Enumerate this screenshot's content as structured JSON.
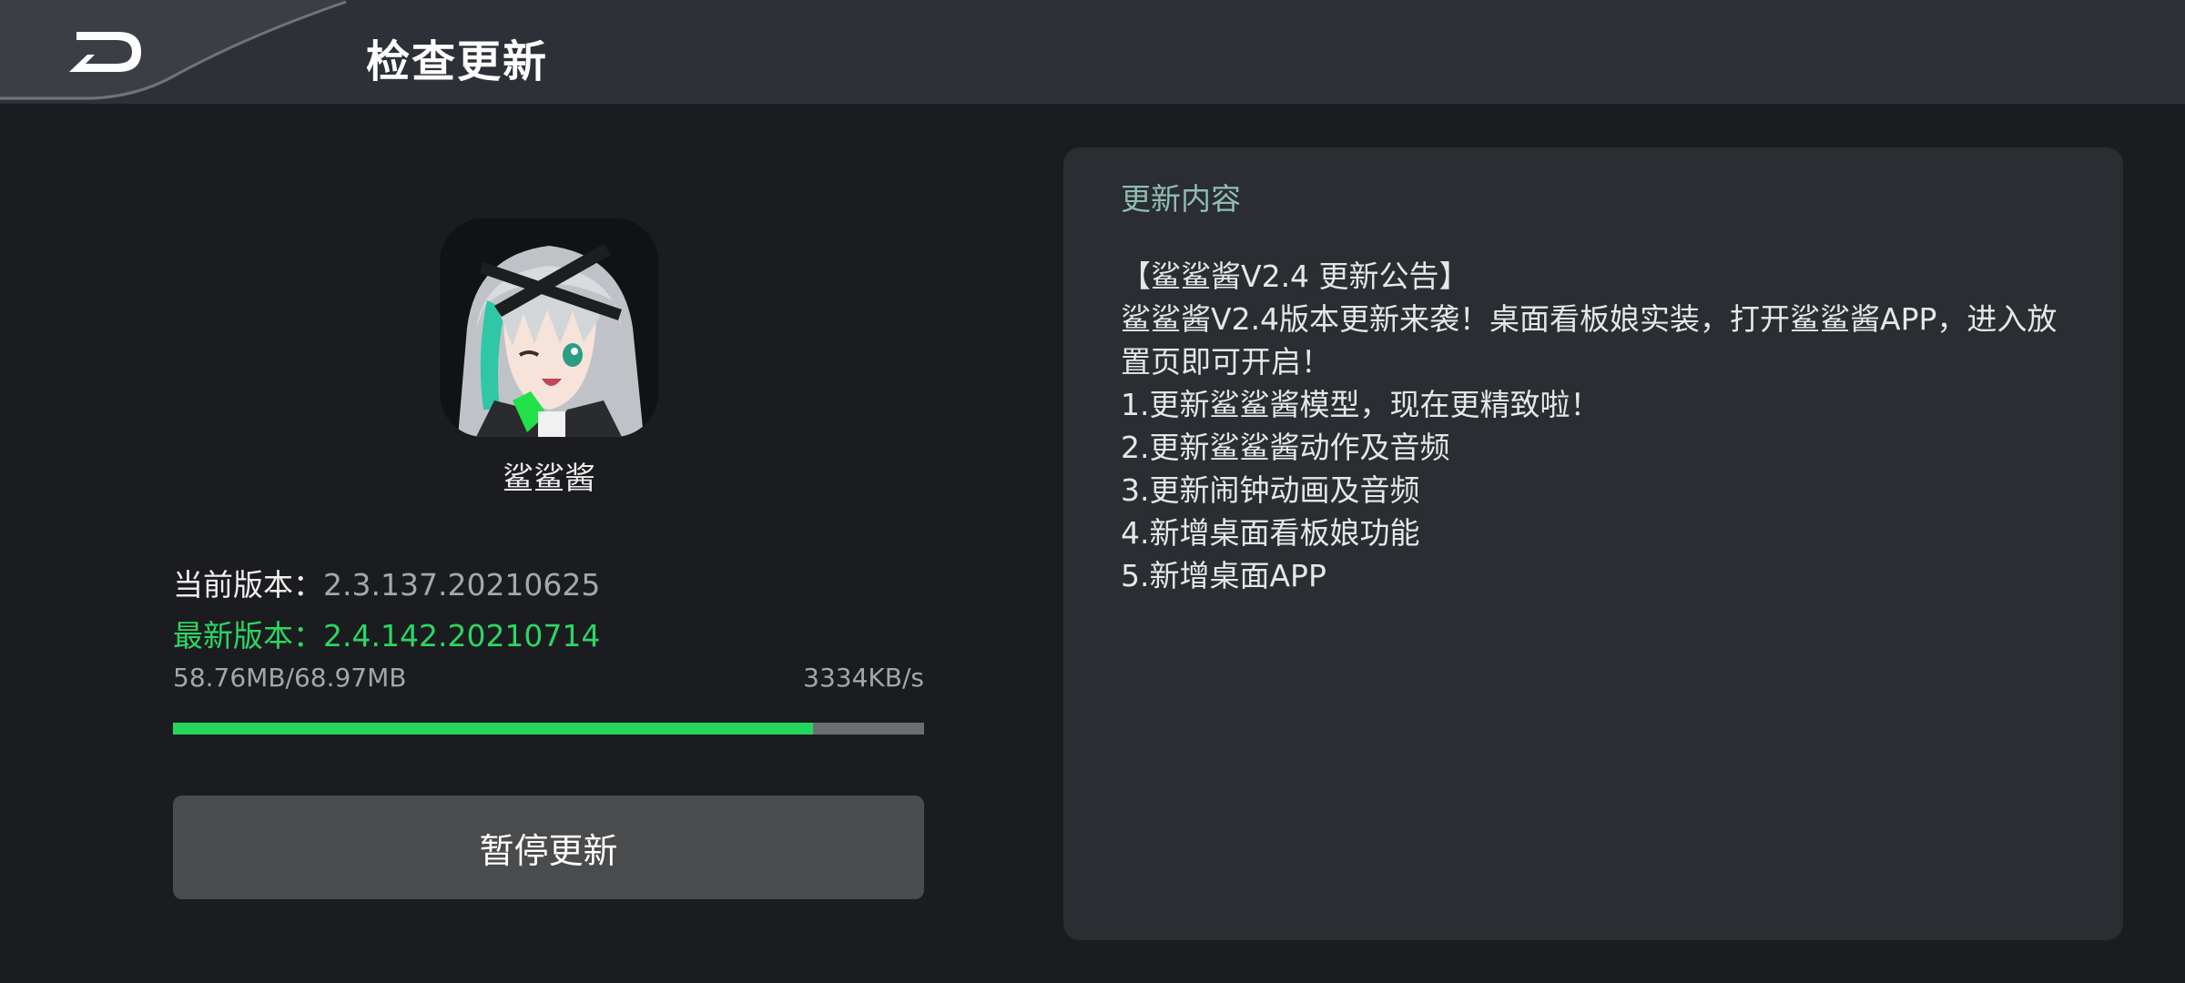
{
  "header": {
    "title": "检查更新",
    "back_icon": "back-arrow-icon"
  },
  "app": {
    "name": "鲨鲨酱",
    "icon": "app-avatar-icon"
  },
  "versions": {
    "current_label": "当前版本：",
    "current_value": "2.3.137.20210625",
    "latest_label": "最新版本：",
    "latest_value": "2.4.142.20210714"
  },
  "download": {
    "progress_text": "58.76MB/68.97MB",
    "speed": "3334KB/s",
    "progress_fraction": 0.852,
    "fill_color": "#25d65e"
  },
  "pause_button_label": "暂停更新",
  "notes": {
    "title": "更新内容",
    "lines": [
      "【鲨鲨酱V2.4 更新公告】",
      "鲨鲨酱V2.4版本更新来袭！桌面看板娘实装，打开鲨鲨酱APP，进入放置页即可开启！",
      "1.更新鲨鲨酱模型，现在更精致啦！",
      "2.更新鲨鲨酱动作及音频",
      "3.更新闹钟动画及音频",
      "4.新增桌面看板娘功能",
      "5.新增桌面APP"
    ]
  }
}
